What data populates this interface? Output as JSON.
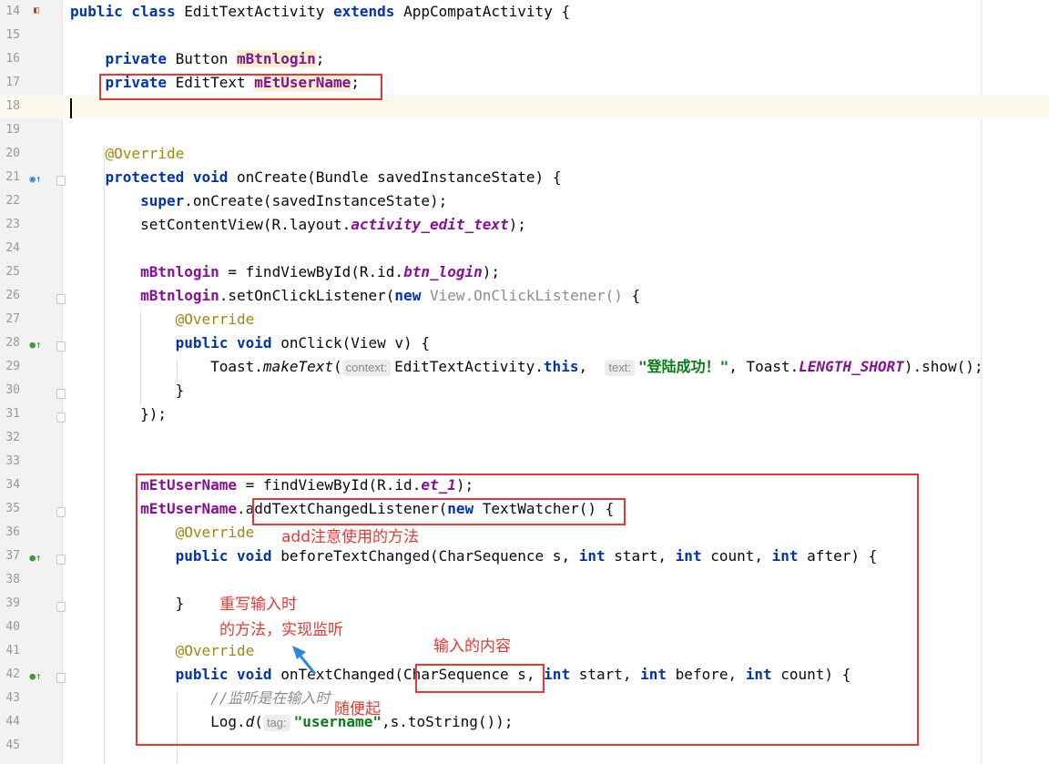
{
  "editor": {
    "lines": [
      {
        "n": "14",
        "segs": [
          [
            "kw",
            "public class "
          ],
          [
            "",
            "EditTextActivity "
          ],
          [
            "kw",
            "extends "
          ],
          [
            "",
            "AppCompatActivity {"
          ]
        ]
      },
      {
        "n": "15",
        "segs": []
      },
      {
        "n": "16",
        "segs": [
          [
            "",
            "    "
          ],
          [
            "kw",
            "private "
          ],
          [
            "",
            "Button "
          ],
          [
            "fldhl",
            "mBtnlogin"
          ],
          [
            "",
            ";"
          ]
        ]
      },
      {
        "n": "17",
        "segs": [
          [
            "",
            "    "
          ],
          [
            "kw",
            "private "
          ],
          [
            "",
            "EditText "
          ],
          [
            "fldhl",
            "mEtUserName"
          ],
          [
            "",
            ";"
          ]
        ]
      },
      {
        "n": "18",
        "segs": []
      },
      {
        "n": "19",
        "segs": []
      },
      {
        "n": "20",
        "segs": [
          [
            "",
            "    "
          ],
          [
            "ann",
            "@Override"
          ]
        ]
      },
      {
        "n": "21",
        "segs": [
          [
            "",
            "    "
          ],
          [
            "kw",
            "protected void "
          ],
          [
            "",
            "onCreate(Bundle savedInstanceState) {"
          ]
        ]
      },
      {
        "n": "22",
        "segs": [
          [
            "",
            "        "
          ],
          [
            "kw",
            "super"
          ],
          [
            "",
            ".onCreate(savedInstanceState);"
          ]
        ]
      },
      {
        "n": "23",
        "segs": [
          [
            "",
            "        setContentView(R.layout."
          ],
          [
            "italfld",
            "activity_edit_text"
          ],
          [
            "",
            ");"
          ]
        ]
      },
      {
        "n": "24",
        "segs": []
      },
      {
        "n": "25",
        "segs": [
          [
            "",
            "        "
          ],
          [
            "fld",
            "mBtnlogin"
          ],
          [
            "",
            " = findViewById(R.id."
          ],
          [
            "italfld",
            "btn_login"
          ],
          [
            "",
            ");"
          ]
        ]
      },
      {
        "n": "26",
        "segs": [
          [
            "",
            "        "
          ],
          [
            "fld",
            "mBtnlogin"
          ],
          [
            "",
            ".setOnClickListener("
          ],
          [
            "kw",
            "new "
          ],
          [
            "gray",
            "View.OnClickListener() "
          ],
          [
            "",
            "{"
          ]
        ]
      },
      {
        "n": "27",
        "segs": [
          [
            "",
            "            "
          ],
          [
            "ann",
            "@Override"
          ]
        ]
      },
      {
        "n": "28",
        "segs": [
          [
            "",
            "            "
          ],
          [
            "kw",
            "public void "
          ],
          [
            "",
            "onClick(View v) {"
          ]
        ]
      },
      {
        "n": "29",
        "segs": [
          [
            "",
            "                Toast."
          ],
          [
            "ital",
            "makeText"
          ],
          [
            "",
            "("
          ],
          [
            "hint",
            "context:"
          ],
          [
            "",
            "EditTextActivity."
          ],
          [
            "kw",
            "this"
          ],
          [
            "",
            ",  "
          ],
          [
            "hint",
            "text:"
          ],
          [
            "str",
            "\"登陆成功！\""
          ],
          [
            "",
            ", Toast."
          ],
          [
            "italfld",
            "LENGTH_SHORT"
          ],
          [
            "",
            ").show();"
          ]
        ]
      },
      {
        "n": "30",
        "segs": [
          [
            "",
            "            }"
          ]
        ]
      },
      {
        "n": "31",
        "segs": [
          [
            "",
            "        });"
          ]
        ]
      },
      {
        "n": "32",
        "segs": []
      },
      {
        "n": "33",
        "segs": []
      },
      {
        "n": "34",
        "segs": [
          [
            "",
            "        "
          ],
          [
            "fld",
            "mEtUserName"
          ],
          [
            "",
            " = findViewById(R.id."
          ],
          [
            "italfld",
            "et_1"
          ],
          [
            "",
            ");"
          ]
        ]
      },
      {
        "n": "35",
        "segs": [
          [
            "",
            "        "
          ],
          [
            "fld",
            "mEtUserName"
          ],
          [
            "",
            ".addTextChangedListener("
          ],
          [
            "kw",
            "new "
          ],
          [
            "",
            "TextWatcher() {"
          ]
        ]
      },
      {
        "n": "36",
        "segs": [
          [
            "",
            "            "
          ],
          [
            "ann",
            "@Override"
          ]
        ]
      },
      {
        "n": "37",
        "segs": [
          [
            "",
            "            "
          ],
          [
            "kw",
            "public void "
          ],
          [
            "",
            "beforeTextChanged(CharSequence s, "
          ],
          [
            "kw",
            "int "
          ],
          [
            "",
            "start, "
          ],
          [
            "kw",
            "int "
          ],
          [
            "",
            "count, "
          ],
          [
            "kw",
            "int "
          ],
          [
            "",
            "after) {"
          ]
        ]
      },
      {
        "n": "38",
        "segs": []
      },
      {
        "n": "39",
        "segs": [
          [
            "",
            "            }"
          ]
        ]
      },
      {
        "n": "40",
        "segs": []
      },
      {
        "n": "41",
        "segs": [
          [
            "",
            "            "
          ],
          [
            "ann",
            "@Override"
          ]
        ]
      },
      {
        "n": "42",
        "segs": [
          [
            "",
            "            "
          ],
          [
            "kw",
            "public void "
          ],
          [
            "",
            "onTextChanged(CharSequence s, "
          ],
          [
            "kw",
            "int "
          ],
          [
            "",
            "start, "
          ],
          [
            "kw",
            "int "
          ],
          [
            "",
            "before, "
          ],
          [
            "kw",
            "int "
          ],
          [
            "",
            "count) {"
          ]
        ]
      },
      {
        "n": "43",
        "segs": [
          [
            "",
            "                "
          ],
          [
            "cmt",
            "//监听是在输入时"
          ]
        ]
      },
      {
        "n": "44",
        "segs": [
          [
            "",
            "                Log."
          ],
          [
            "ital",
            "d"
          ],
          [
            "",
            "("
          ],
          [
            "hint",
            "tag:"
          ],
          [
            "str",
            "\"username\""
          ],
          [
            "",
            ",s.toString());"
          ]
        ]
      },
      {
        "n": "45",
        "segs": []
      }
    ]
  },
  "annotations": {
    "add_note": "add注意使用的方法",
    "override_note_line1": "重写输入时",
    "override_note_line2": "的方法，实现监听",
    "input_note": "输入的内容",
    "random_note": "随便起"
  },
  "colors": {
    "annotation_red": "#e53935",
    "keyword": "#0033b3",
    "field": "#871094",
    "string": "#067d17",
    "annotation": "#9e880d"
  },
  "gutter_icons": {
    "line14": "file-type-icon",
    "override_markers": "overriding-method-icon",
    "implement_markers": "implementing-method-icon"
  }
}
